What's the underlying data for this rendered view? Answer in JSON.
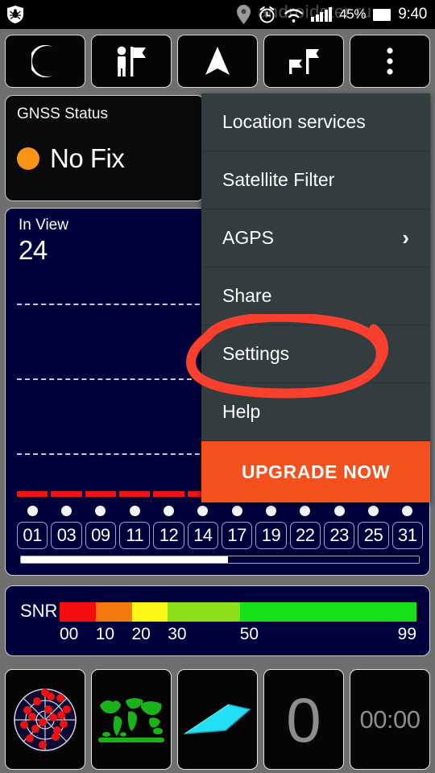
{
  "statusbar": {
    "left_icons": [
      "shield-bug-icon"
    ],
    "right_icons": [
      "location-pin-icon",
      "alarm-clock-icon",
      "wifi-icon",
      "signal-bars-icon",
      "battery-icon"
    ],
    "battery_percent": "45%",
    "time": "9:40",
    "watermark": "androidster.ru"
  },
  "toolbar_top": {
    "buttons": [
      {
        "name": "night-mode-button",
        "icon": "moon-icon"
      },
      {
        "name": "set-waypoint-button",
        "icon": "person-with-flag-icon"
      },
      {
        "name": "navigation-button",
        "icon": "navigation-arrow-icon"
      },
      {
        "name": "waypoints-button",
        "icon": "two-flags-icon"
      },
      {
        "name": "overflow-menu-button",
        "icon": "three-dots-vertical-icon"
      }
    ]
  },
  "gnss_status": {
    "label": "GNSS Status",
    "value": "No Fix",
    "indicator_color": "#f79416"
  },
  "in_view": {
    "label": "In View",
    "value": "24"
  },
  "menu": {
    "items": [
      {
        "label": "Location services",
        "has_chevron": false
      },
      {
        "label": "Satellite Filter",
        "has_chevron": false
      },
      {
        "label": "AGPS",
        "has_chevron": true
      },
      {
        "label": "Share",
        "has_chevron": false
      },
      {
        "label": "Settings",
        "has_chevron": false
      },
      {
        "label": "Help",
        "has_chevron": false
      }
    ],
    "chevron_glyph": "›",
    "upgrade_label": "UPGRADE NOW",
    "upgrade_color": "#f4511e"
  },
  "annotation": {
    "shape": "hand-drawn-ellipse",
    "target": "Settings",
    "color": "#f9402e"
  },
  "snr_legend": {
    "label": "SNR",
    "ticks": [
      "00",
      "10",
      "20",
      "30",
      "50",
      "99"
    ],
    "bands": [
      {
        "color": "#f40d0d",
        "from": 0,
        "to": 10
      },
      {
        "color": "#f47a10",
        "from": 10,
        "to": 20
      },
      {
        "color": "#fbf417",
        "from": 20,
        "to": 30
      },
      {
        "color": "#8ce01b",
        "from": 30,
        "to": 50
      },
      {
        "color": "#17e01b",
        "from": 50,
        "to": 99
      }
    ]
  },
  "toolbar_bottom": {
    "buttons": [
      {
        "name": "sky-plot-button",
        "icon": "radar-skyplot-icon",
        "label": ""
      },
      {
        "name": "world-map-button",
        "icon": "world-map-icon",
        "label": ""
      },
      {
        "name": "compass-button",
        "icon": "compass-arrow-icon",
        "label": ""
      },
      {
        "name": "speed-button",
        "icon": "speed-readout",
        "label": "0"
      },
      {
        "name": "timer-button",
        "icon": "timer-readout",
        "label": "00:00"
      }
    ]
  },
  "chart_data": {
    "type": "bar",
    "title": "In View",
    "xlabel": "",
    "ylabel": "SNR",
    "ylim": [
      0,
      99
    ],
    "grid": true,
    "gridlines": [
      75,
      50,
      25
    ],
    "categories": [
      "01",
      "03",
      "09",
      "11",
      "12",
      "14",
      "17",
      "19",
      "22",
      "23",
      "25",
      "31"
    ],
    "values": [
      7,
      7,
      7,
      7,
      7,
      7,
      6,
      6,
      6,
      6,
      6,
      6
    ],
    "bar_color": "#f01414",
    "scroll_position_percent": 52,
    "legend": []
  }
}
